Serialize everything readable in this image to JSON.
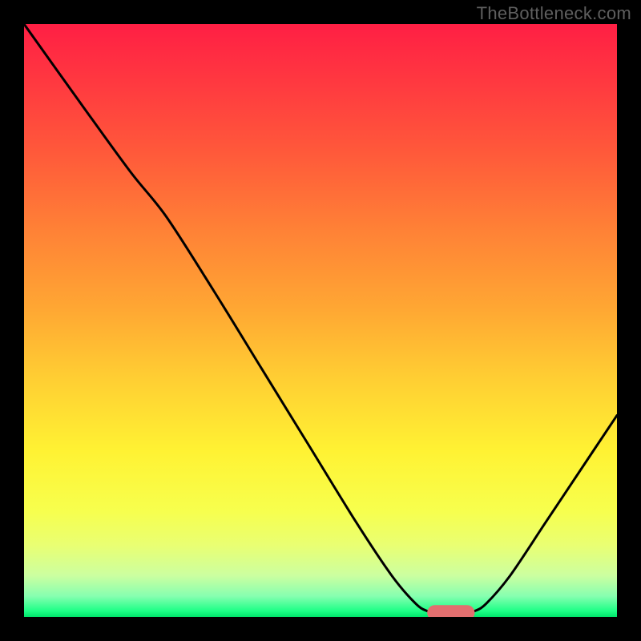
{
  "watermark": "TheBottleneck.com",
  "chart_data": {
    "type": "line",
    "title": "",
    "xlabel": "",
    "ylabel": "",
    "xlim": [
      0,
      100
    ],
    "ylim": [
      0,
      100
    ],
    "curve": [
      {
        "x": 0,
        "y": 100
      },
      {
        "x": 10,
        "y": 86
      },
      {
        "x": 18,
        "y": 75
      },
      {
        "x": 24,
        "y": 67.5
      },
      {
        "x": 32,
        "y": 55
      },
      {
        "x": 40,
        "y": 42
      },
      {
        "x": 48,
        "y": 29
      },
      {
        "x": 56,
        "y": 16
      },
      {
        "x": 62,
        "y": 7
      },
      {
        "x": 66,
        "y": 2.3
      },
      {
        "x": 68,
        "y": 1.0
      },
      {
        "x": 70,
        "y": 0.7
      },
      {
        "x": 74,
        "y": 0.7
      },
      {
        "x": 76,
        "y": 1.0
      },
      {
        "x": 78,
        "y": 2.3
      },
      {
        "x": 82,
        "y": 7
      },
      {
        "x": 88,
        "y": 16
      },
      {
        "x": 94,
        "y": 25
      },
      {
        "x": 100,
        "y": 34
      }
    ],
    "marker": {
      "x": 72,
      "y": 0.7,
      "rx": 4.0,
      "ry": 1.3
    },
    "gradient_stops": [
      {
        "offset": 0.0,
        "color": "#ff1f44"
      },
      {
        "offset": 0.1,
        "color": "#ff3940"
      },
      {
        "offset": 0.22,
        "color": "#ff5a3a"
      },
      {
        "offset": 0.35,
        "color": "#ff8236"
      },
      {
        "offset": 0.48,
        "color": "#ffa733"
      },
      {
        "offset": 0.6,
        "color": "#ffcf33"
      },
      {
        "offset": 0.72,
        "color": "#fff233"
      },
      {
        "offset": 0.82,
        "color": "#f7ff4d"
      },
      {
        "offset": 0.88,
        "color": "#e9ff73"
      },
      {
        "offset": 0.93,
        "color": "#ccffa0"
      },
      {
        "offset": 0.965,
        "color": "#86ffb0"
      },
      {
        "offset": 0.99,
        "color": "#1dff86"
      },
      {
        "offset": 1.0,
        "color": "#00e56b"
      }
    ],
    "curve_color": "#000000",
    "curve_width": 3,
    "marker_color": "#e36f6f"
  }
}
